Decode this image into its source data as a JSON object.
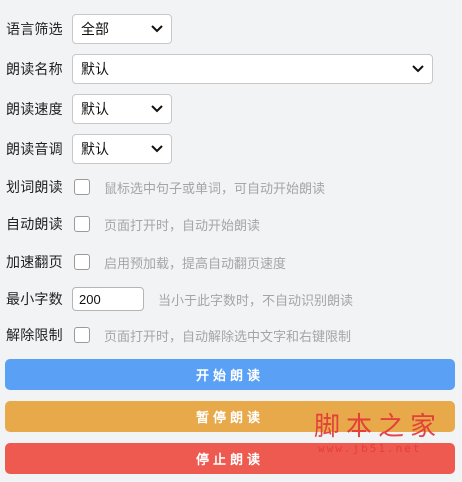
{
  "settings": {
    "language_filter": {
      "label": "语言筛选",
      "value": "全部"
    },
    "voice_name": {
      "label": "朗读名称",
      "value": "默认"
    },
    "speed": {
      "label": "朗读速度",
      "value": "默认"
    },
    "pitch": {
      "label": "朗读音调",
      "value": "默认"
    },
    "select_to_read": {
      "label": "划词朗读",
      "checked": false,
      "hint": "鼠标选中句子或单词，可自动开始朗读"
    },
    "auto_read": {
      "label": "自动朗读",
      "checked": false,
      "hint": "页面打开时，自动开始朗读"
    },
    "fast_page": {
      "label": "加速翻页",
      "checked": false,
      "hint": "启用预加载，提高自动翻页速度"
    },
    "min_chars": {
      "label": "最小字数",
      "value": "200",
      "hint": "当小于此字数时，不自动识别朗读"
    },
    "remove_restrictions": {
      "label": "解除限制",
      "checked": false,
      "hint": "页面打开时，自动解除选中文字和右键限制"
    }
  },
  "buttons": {
    "start": {
      "label": "开始朗读",
      "color": "#5aa0f5"
    },
    "pause": {
      "label": "暂停朗读",
      "color": "#e8a94a"
    },
    "stop": {
      "label": "停止朗读",
      "color": "#ee5a50"
    }
  },
  "watermark": {
    "text": "脚本之家",
    "url": "www.jb51.net",
    "color": "#e33b3b"
  },
  "icons": {
    "dropdown": "chevron-down-icon"
  }
}
